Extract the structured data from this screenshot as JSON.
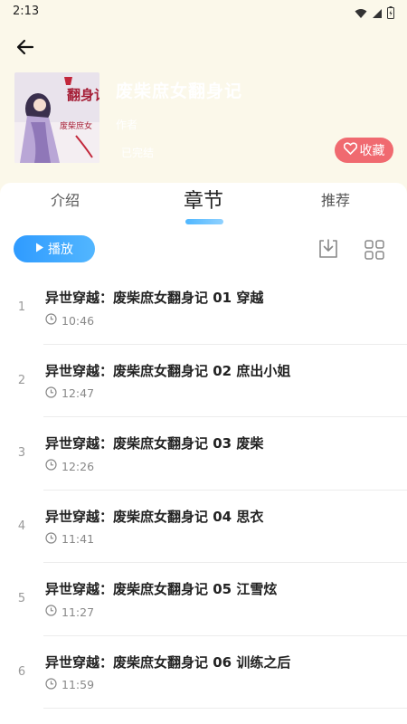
{
  "status_bar": {
    "time": "2:13"
  },
  "book": {
    "title": "废柴庶女翻身记",
    "author": "作者",
    "status": "已完结",
    "cover_text": "翻身记",
    "cover_subtext": "废柴庶女",
    "favorite_label": "收藏"
  },
  "tabs": [
    {
      "label": "介绍"
    },
    {
      "label": "章节"
    },
    {
      "label": "推荐"
    }
  ],
  "toolbar": {
    "play_label": "播放"
  },
  "chapters": [
    {
      "index": "1",
      "title": "异世穿越：废柴庶女翻身记 01 穿越",
      "duration": "10:46"
    },
    {
      "index": "2",
      "title": "异世穿越：废柴庶女翻身记 02 庶出小姐",
      "duration": "12:47"
    },
    {
      "index": "3",
      "title": "异世穿越：废柴庶女翻身记 03 废柴",
      "duration": "12:26"
    },
    {
      "index": "4",
      "title": "异世穿越：废柴庶女翻身记 04 思衣",
      "duration": "11:41"
    },
    {
      "index": "5",
      "title": "异世穿越：废柴庶女翻身记 05 江雪炫",
      "duration": "11:27"
    },
    {
      "index": "6",
      "title": "异世穿越：废柴庶女翻身记 06 训练之后",
      "duration": "11:59"
    }
  ],
  "colors": {
    "header_bg": "#fbf8ea",
    "accent_blue": "#2f9bff",
    "favorite_pink": "#f06a70"
  },
  "icons": {
    "back": "arrow-left-icon",
    "favorite": "heart-icon",
    "play": "play-icon",
    "download": "download-icon",
    "grid": "grid-icon",
    "clock": "clock-icon"
  }
}
